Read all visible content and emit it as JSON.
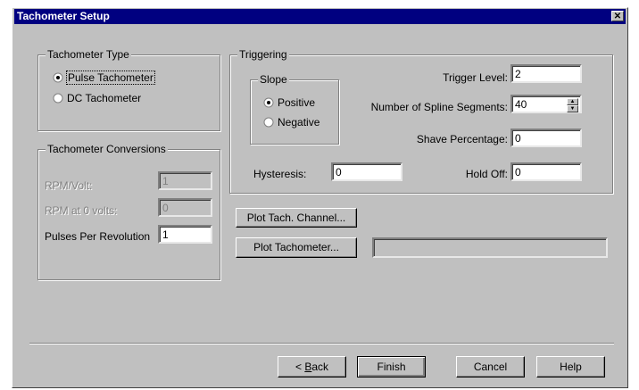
{
  "window": {
    "title": "Tachometer Setup",
    "close_glyph": "✕"
  },
  "tach_type": {
    "legend": "Tachometer Type",
    "options": [
      {
        "label": "Pulse Tachometer",
        "selected": true
      },
      {
        "label": "DC Tachometer",
        "selected": false
      }
    ]
  },
  "conversions": {
    "legend": "Tachometer Conversions",
    "rpm_per_volt": {
      "label": "RPM/Volt:",
      "value": "1"
    },
    "rpm_zero": {
      "label": "RPM at 0 volts:",
      "value": "0"
    },
    "pulses": {
      "label": "Pulses Per Revolution",
      "value": "1"
    }
  },
  "triggering": {
    "legend": "Triggering",
    "slope": {
      "legend": "Slope",
      "options": [
        {
          "label": "Positive",
          "selected": true
        },
        {
          "label": "Negative",
          "selected": false
        }
      ]
    },
    "trigger_level": {
      "label": "Trigger Level:",
      "value": "2"
    },
    "spline_segments": {
      "label": "Number of Spline Segments:",
      "value": "40"
    },
    "shave": {
      "label": "Shave Percentage:",
      "value": "0"
    },
    "hysteresis": {
      "label": "Hysteresis:",
      "value": "0"
    },
    "hold_off": {
      "label": "Hold Off:",
      "value": "0"
    }
  },
  "actions": {
    "plot_channel": "Plot Tach. Channel...",
    "plot_tach": "Plot Tachometer...",
    "plot_status": ""
  },
  "footer": {
    "back_key": "B",
    "back_rest": "ack",
    "finish": "Finish",
    "cancel": "Cancel",
    "help": "Help"
  }
}
